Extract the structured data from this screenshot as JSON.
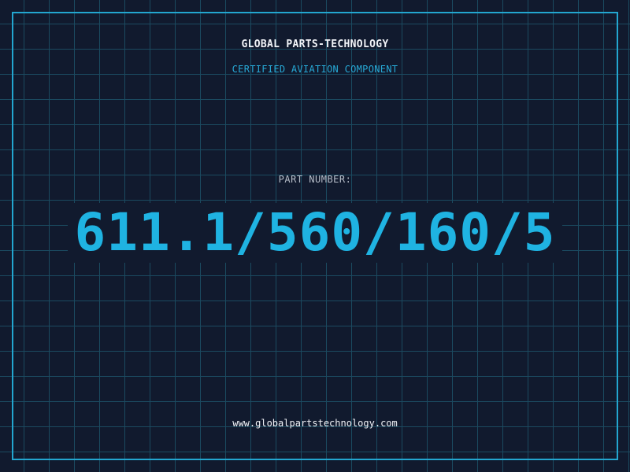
{
  "header": {
    "company": "GLOBAL PARTS-TECHNOLOGY",
    "subtitle": "CERTIFIED AVIATION COMPONENT"
  },
  "part": {
    "label": "PART NUMBER:",
    "number": "611.1/560/160/5"
  },
  "footer": {
    "website": "www.globalpartstechnology.com"
  },
  "colors": {
    "background": "#111a2e",
    "grid": "#1b4a60",
    "frame": "#23a6cf",
    "accent": "#1fb3e2",
    "text": "#f2f4f8",
    "label": "#b7bec9"
  }
}
